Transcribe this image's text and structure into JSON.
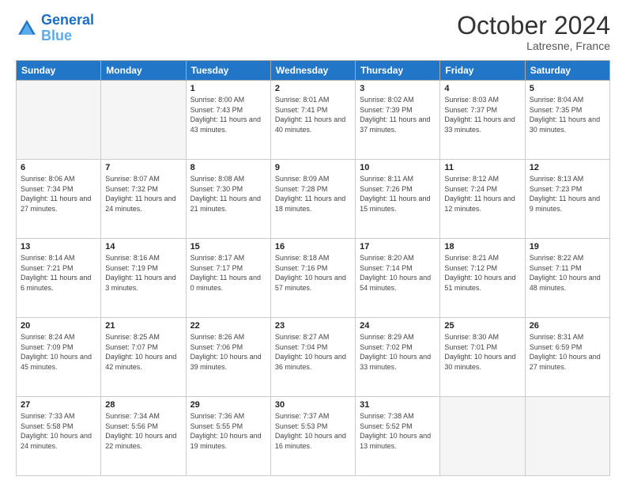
{
  "logo": {
    "line1": "General",
    "line2": "Blue"
  },
  "header": {
    "month": "October 2024",
    "location": "Latresne, France"
  },
  "weekdays": [
    "Sunday",
    "Monday",
    "Tuesday",
    "Wednesday",
    "Thursday",
    "Friday",
    "Saturday"
  ],
  "weeks": [
    [
      {
        "day": "",
        "info": ""
      },
      {
        "day": "",
        "info": ""
      },
      {
        "day": "1",
        "info": "Sunrise: 8:00 AM\nSunset: 7:43 PM\nDaylight: 11 hours and 43 minutes."
      },
      {
        "day": "2",
        "info": "Sunrise: 8:01 AM\nSunset: 7:41 PM\nDaylight: 11 hours and 40 minutes."
      },
      {
        "day": "3",
        "info": "Sunrise: 8:02 AM\nSunset: 7:39 PM\nDaylight: 11 hours and 37 minutes."
      },
      {
        "day": "4",
        "info": "Sunrise: 8:03 AM\nSunset: 7:37 PM\nDaylight: 11 hours and 33 minutes."
      },
      {
        "day": "5",
        "info": "Sunrise: 8:04 AM\nSunset: 7:35 PM\nDaylight: 11 hours and 30 minutes."
      }
    ],
    [
      {
        "day": "6",
        "info": "Sunrise: 8:06 AM\nSunset: 7:34 PM\nDaylight: 11 hours and 27 minutes."
      },
      {
        "day": "7",
        "info": "Sunrise: 8:07 AM\nSunset: 7:32 PM\nDaylight: 11 hours and 24 minutes."
      },
      {
        "day": "8",
        "info": "Sunrise: 8:08 AM\nSunset: 7:30 PM\nDaylight: 11 hours and 21 minutes."
      },
      {
        "day": "9",
        "info": "Sunrise: 8:09 AM\nSunset: 7:28 PM\nDaylight: 11 hours and 18 minutes."
      },
      {
        "day": "10",
        "info": "Sunrise: 8:11 AM\nSunset: 7:26 PM\nDaylight: 11 hours and 15 minutes."
      },
      {
        "day": "11",
        "info": "Sunrise: 8:12 AM\nSunset: 7:24 PM\nDaylight: 11 hours and 12 minutes."
      },
      {
        "day": "12",
        "info": "Sunrise: 8:13 AM\nSunset: 7:23 PM\nDaylight: 11 hours and 9 minutes."
      }
    ],
    [
      {
        "day": "13",
        "info": "Sunrise: 8:14 AM\nSunset: 7:21 PM\nDaylight: 11 hours and 6 minutes."
      },
      {
        "day": "14",
        "info": "Sunrise: 8:16 AM\nSunset: 7:19 PM\nDaylight: 11 hours and 3 minutes."
      },
      {
        "day": "15",
        "info": "Sunrise: 8:17 AM\nSunset: 7:17 PM\nDaylight: 11 hours and 0 minutes."
      },
      {
        "day": "16",
        "info": "Sunrise: 8:18 AM\nSunset: 7:16 PM\nDaylight: 10 hours and 57 minutes."
      },
      {
        "day": "17",
        "info": "Sunrise: 8:20 AM\nSunset: 7:14 PM\nDaylight: 10 hours and 54 minutes."
      },
      {
        "day": "18",
        "info": "Sunrise: 8:21 AM\nSunset: 7:12 PM\nDaylight: 10 hours and 51 minutes."
      },
      {
        "day": "19",
        "info": "Sunrise: 8:22 AM\nSunset: 7:11 PM\nDaylight: 10 hours and 48 minutes."
      }
    ],
    [
      {
        "day": "20",
        "info": "Sunrise: 8:24 AM\nSunset: 7:09 PM\nDaylight: 10 hours and 45 minutes."
      },
      {
        "day": "21",
        "info": "Sunrise: 8:25 AM\nSunset: 7:07 PM\nDaylight: 10 hours and 42 minutes."
      },
      {
        "day": "22",
        "info": "Sunrise: 8:26 AM\nSunset: 7:06 PM\nDaylight: 10 hours and 39 minutes."
      },
      {
        "day": "23",
        "info": "Sunrise: 8:27 AM\nSunset: 7:04 PM\nDaylight: 10 hours and 36 minutes."
      },
      {
        "day": "24",
        "info": "Sunrise: 8:29 AM\nSunset: 7:02 PM\nDaylight: 10 hours and 33 minutes."
      },
      {
        "day": "25",
        "info": "Sunrise: 8:30 AM\nSunset: 7:01 PM\nDaylight: 10 hours and 30 minutes."
      },
      {
        "day": "26",
        "info": "Sunrise: 8:31 AM\nSunset: 6:59 PM\nDaylight: 10 hours and 27 minutes."
      }
    ],
    [
      {
        "day": "27",
        "info": "Sunrise: 7:33 AM\nSunset: 5:58 PM\nDaylight: 10 hours and 24 minutes."
      },
      {
        "day": "28",
        "info": "Sunrise: 7:34 AM\nSunset: 5:56 PM\nDaylight: 10 hours and 22 minutes."
      },
      {
        "day": "29",
        "info": "Sunrise: 7:36 AM\nSunset: 5:55 PM\nDaylight: 10 hours and 19 minutes."
      },
      {
        "day": "30",
        "info": "Sunrise: 7:37 AM\nSunset: 5:53 PM\nDaylight: 10 hours and 16 minutes."
      },
      {
        "day": "31",
        "info": "Sunrise: 7:38 AM\nSunset: 5:52 PM\nDaylight: 10 hours and 13 minutes."
      },
      {
        "day": "",
        "info": ""
      },
      {
        "day": "",
        "info": ""
      }
    ]
  ]
}
